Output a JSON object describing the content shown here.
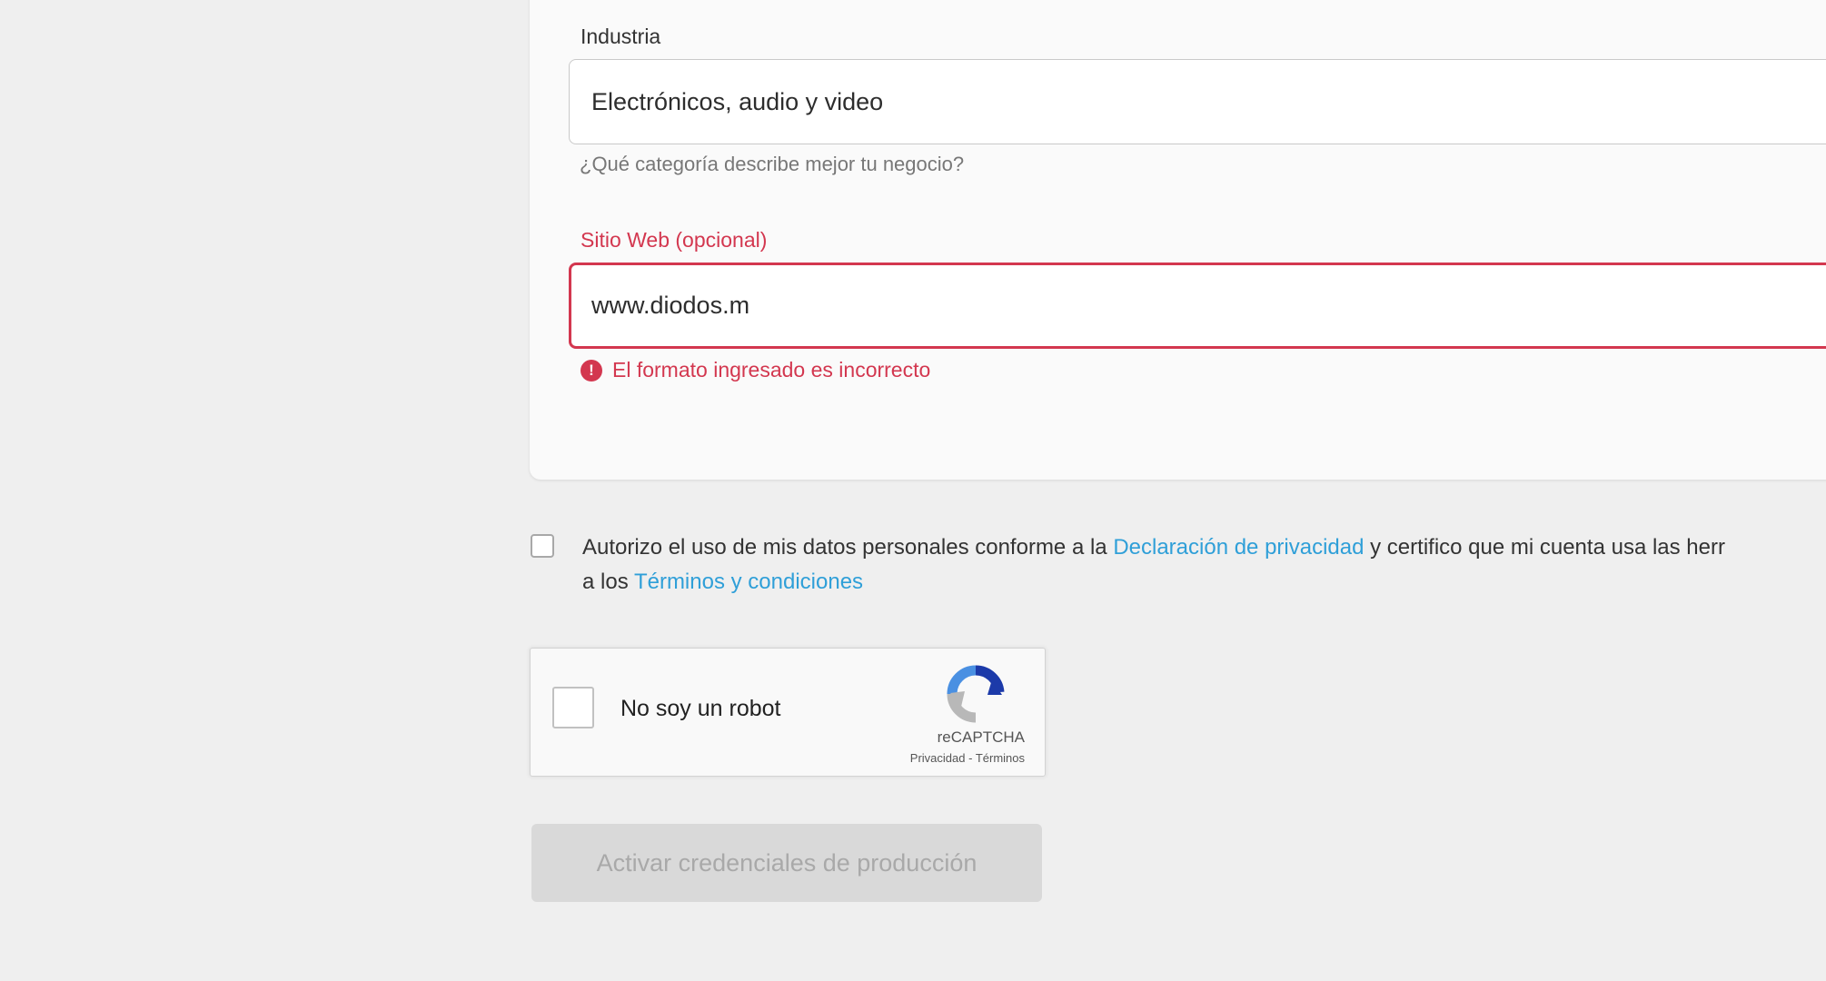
{
  "industry": {
    "label": "Industria",
    "value": "Electrónicos, audio y video",
    "helper": "¿Qué categoría describe mejor tu negocio?"
  },
  "website": {
    "label": "Sitio Web (opcional)",
    "value": "www.diodos.m",
    "error_icon": "!",
    "error": "El formato ingresado es incorrecto"
  },
  "consent": {
    "text_before": "Autorizo el uso de mis datos personales conforme a la ",
    "privacy_link": "Declaración de privacidad",
    "text_middle": " y certifico que mi cuenta usa las herr",
    "text_line2_before": "a los ",
    "terms_link": "Términos y condiciones",
    "checked": false
  },
  "recaptcha": {
    "label": "No soy un robot",
    "brand": "reCAPTCHA",
    "privacy": "Privacidad",
    "separator": " - ",
    "terms": "Términos",
    "checked": false
  },
  "submit": {
    "label": "Activar credenciales de producción",
    "disabled": true
  },
  "colors": {
    "error": "#d3374f",
    "link": "#2f9fd8",
    "background": "#efefef",
    "card": "#fafafa",
    "button_disabled": "#d9d9d9"
  }
}
